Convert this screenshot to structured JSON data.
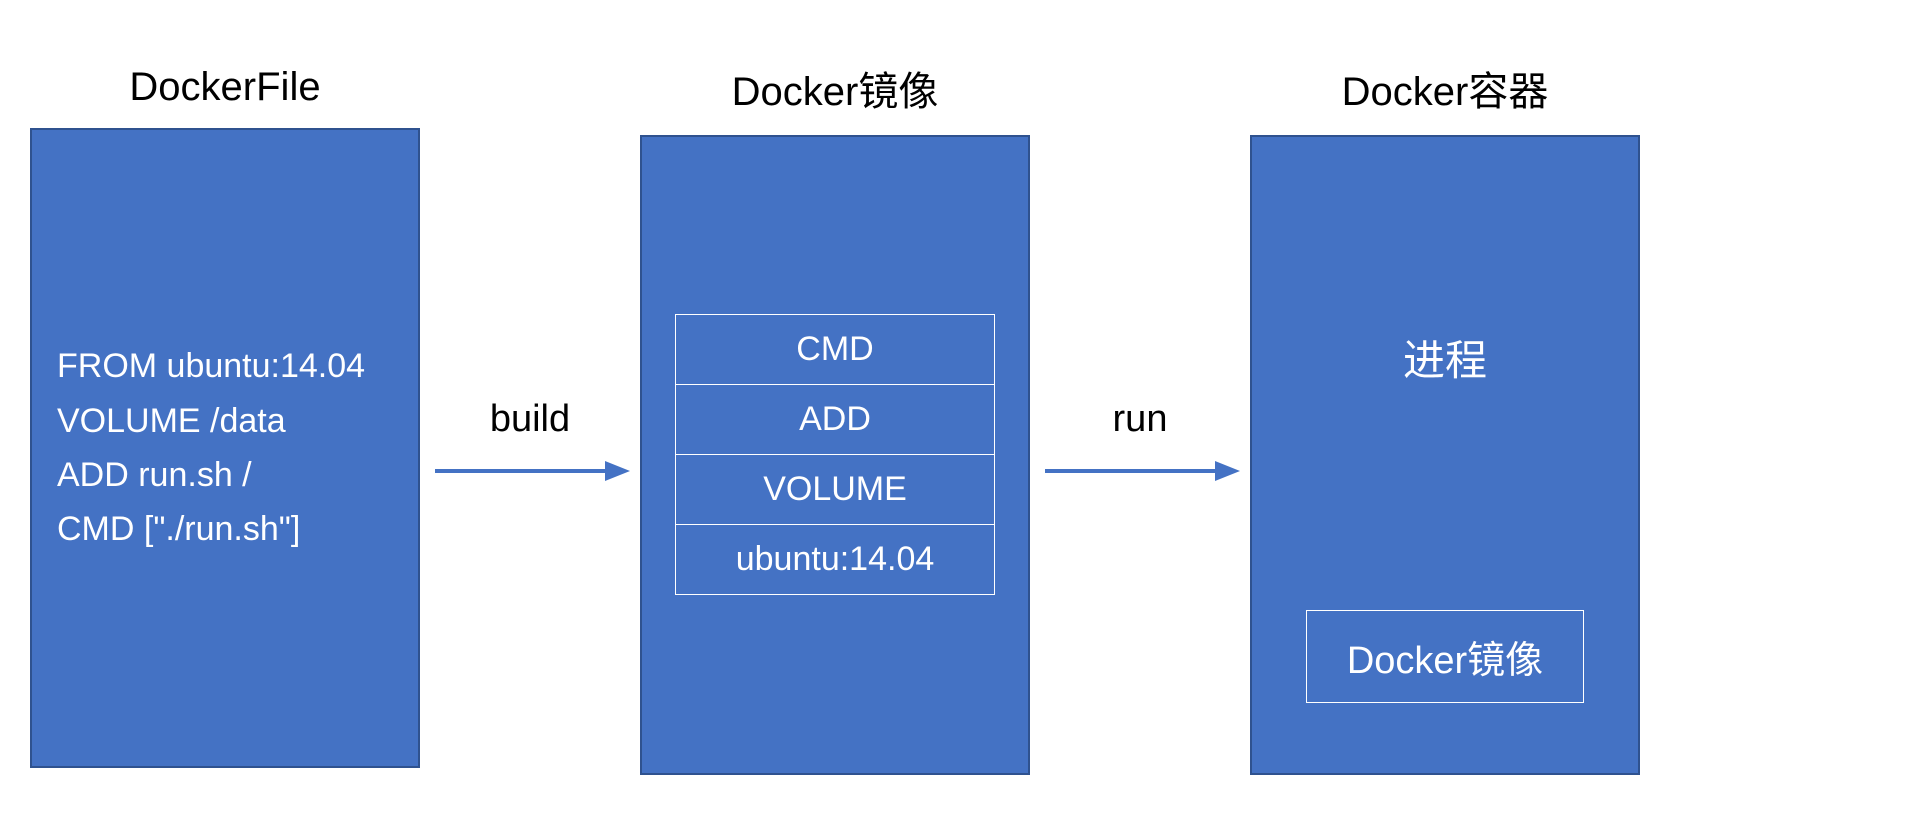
{
  "boxes": {
    "dockerfile": {
      "title": "DockerFile",
      "lines": [
        "FROM ubuntu:14.04",
        "VOLUME /data",
        "ADD run.sh /",
        "CMD [\"./run.sh\"]"
      ]
    },
    "image": {
      "title": "Docker镜像",
      "layers": [
        "CMD",
        "ADD",
        "VOLUME",
        "ubuntu:14.04"
      ]
    },
    "container": {
      "title": "Docker容器",
      "process_label": "进程",
      "inner_box_label": "Docker镜像"
    }
  },
  "arrows": {
    "build": {
      "label": "build"
    },
    "run": {
      "label": "run"
    }
  },
  "colors": {
    "box_fill": "#4472c4",
    "box_border": "#2f528f",
    "arrow": "#4472c4",
    "text_on_box": "#ffffff",
    "text_default": "#000000"
  }
}
